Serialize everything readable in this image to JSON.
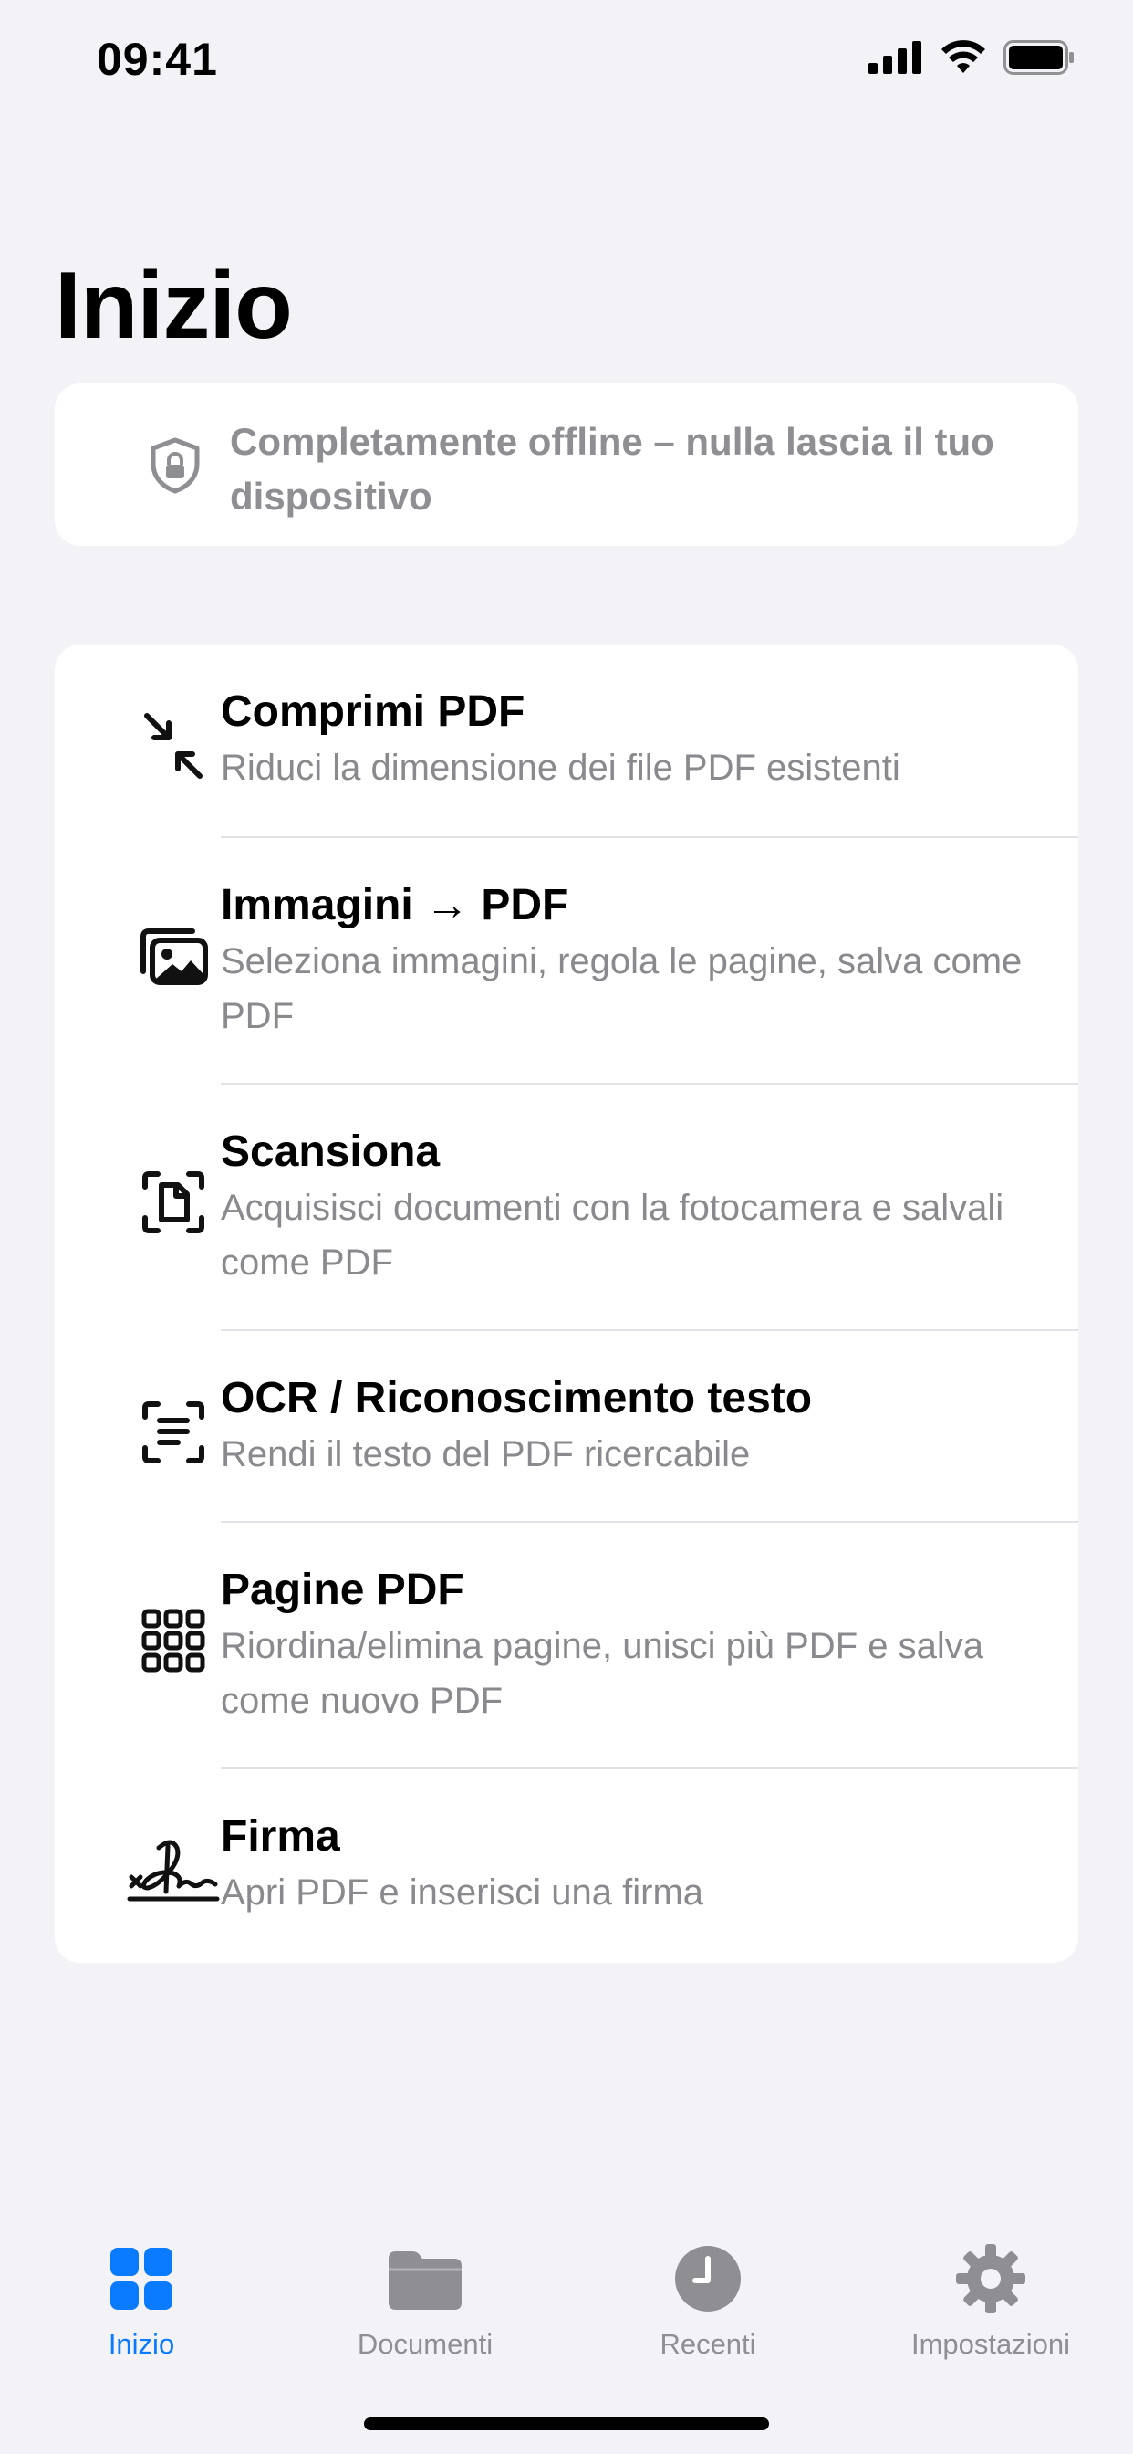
{
  "status": {
    "time": "09:41"
  },
  "title": "Inizio",
  "banner": {
    "text": "Completamente offline – nulla lascia il tuo dispositivo",
    "icon": "shield-lock-icon"
  },
  "items": [
    {
      "title": "Comprimi PDF",
      "subtitle": "Riduci la dimensione dei file PDF esistenti",
      "icon": "compress-arrows-icon"
    },
    {
      "title": "Immagini → PDF",
      "subtitle": "Seleziona immagini, regola le pagine, salva come PDF",
      "icon": "photos-icon"
    },
    {
      "title": "Scansiona",
      "subtitle": "Acquisisci documenti con la fotocamera e salvali come PDF",
      "icon": "document-scan-icon"
    },
    {
      "title": "OCR / Riconoscimento testo",
      "subtitle": "Rendi il testo del PDF ricercabile",
      "icon": "text-scan-icon"
    },
    {
      "title": "Pagine PDF",
      "subtitle": "Riordina/elimina pagine, unisci più PDF e salva come nuovo PDF",
      "icon": "grid-icon"
    },
    {
      "title": "Firma",
      "subtitle": "Apri PDF e inserisci una firma",
      "icon": "signature-icon"
    }
  ],
  "tabs": [
    {
      "label": "Inizio",
      "icon": "grid-squares-icon",
      "active": true
    },
    {
      "label": "Documenti",
      "icon": "folder-icon",
      "active": false
    },
    {
      "label": "Recenti",
      "icon": "clock-icon",
      "active": false
    },
    {
      "label": "Impostazioni",
      "icon": "gear-icon",
      "active": false
    }
  ],
  "colors": {
    "accent": "#0a7aff",
    "background": "#f2f2f7",
    "secondary": "#8e8e93"
  }
}
